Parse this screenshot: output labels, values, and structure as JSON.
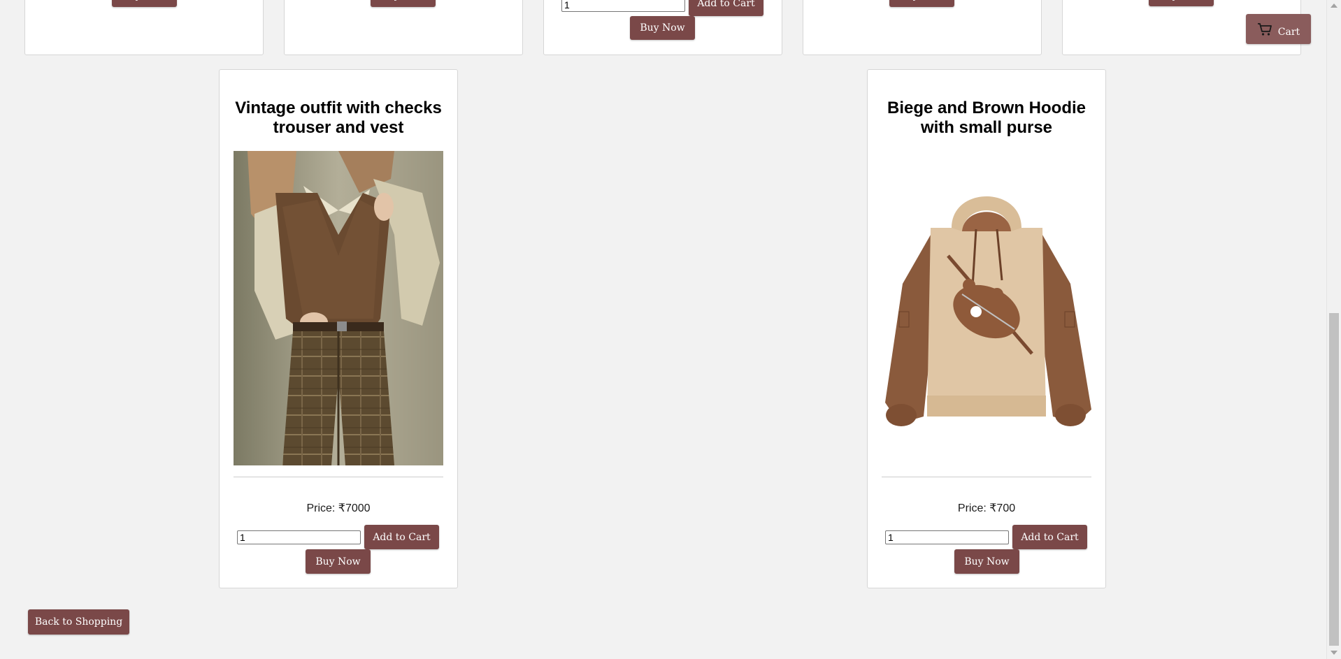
{
  "top_row": {
    "buy_label": "Buy Now",
    "add_to_cart_label": "Add to Cart",
    "qty_value": "1"
  },
  "products": [
    {
      "title": "Vintage outfit with checks trouser and vest",
      "price": "Price: ₹7000",
      "qty_value": "1",
      "add_to_cart_label": "Add to Cart",
      "buy_label": "Buy Now"
    },
    {
      "title": "Biege and Brown Hoodie with small purse",
      "price": "Price: ₹700",
      "qty_value": "1",
      "add_to_cart_label": "Add to Cart",
      "buy_label": "Buy Now"
    }
  ],
  "cart": {
    "label": "Cart",
    "icon": "cart-icon"
  },
  "back_button": {
    "label": "Back to Shopping"
  },
  "colors": {
    "button": "#7a4848",
    "cart_button": "#8a5c5c",
    "background": "#f2f2f2"
  }
}
